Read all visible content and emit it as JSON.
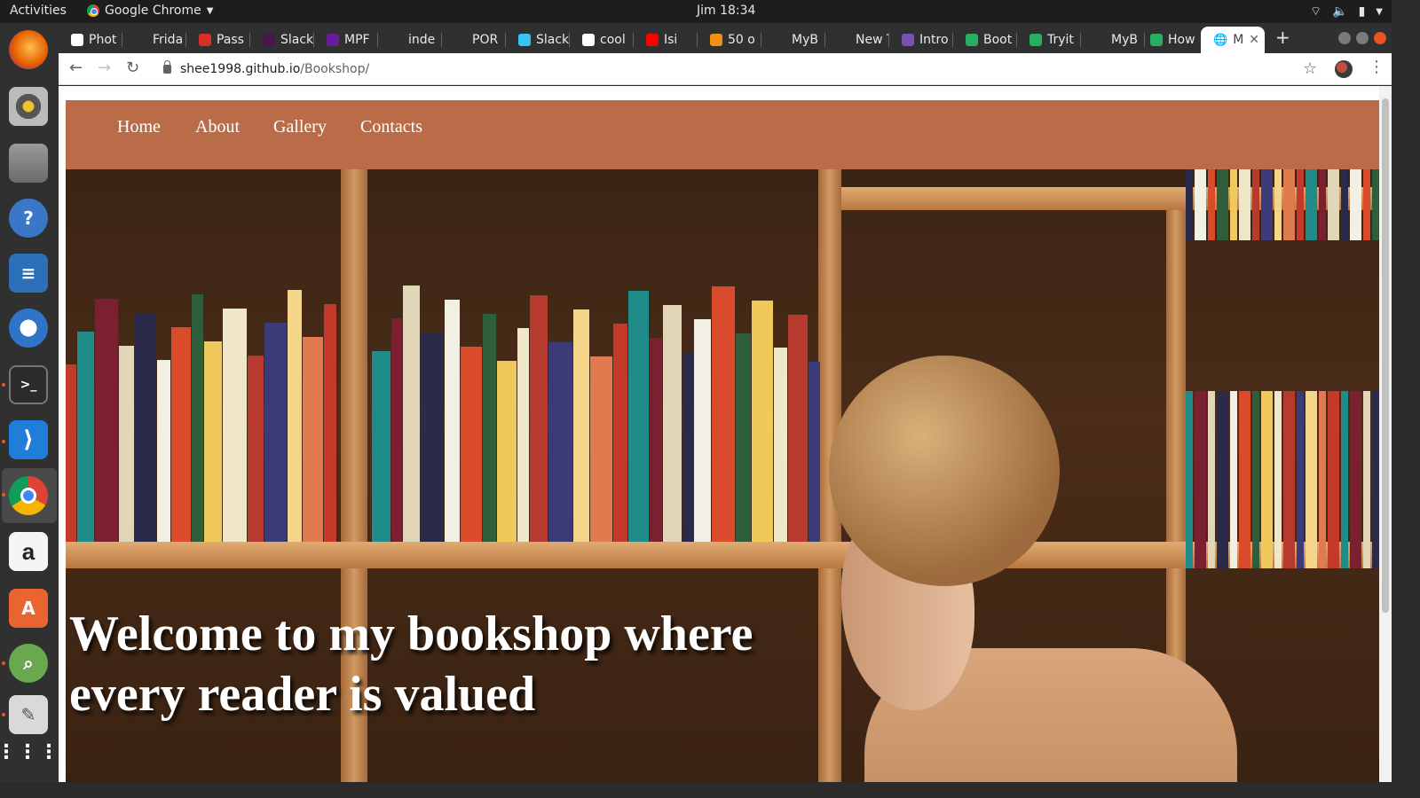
{
  "topbar": {
    "activities": "Activities",
    "app_name": "Google Chrome",
    "clock": "Jim 18:34"
  },
  "dock": {
    "items": [
      {
        "name": "firefox-icon",
        "color": "#e66000"
      },
      {
        "name": "rhythmbox-icon",
        "color": "#777777"
      },
      {
        "name": "files-icon",
        "color": "#8a8a8a"
      },
      {
        "name": "help-icon",
        "color": "#3a77c9"
      },
      {
        "name": "writer-icon",
        "color": "#2a6fb8"
      },
      {
        "name": "thunderbird-icon",
        "color": "#2e74c7"
      },
      {
        "name": "terminal-icon",
        "color": "#2b2b2b"
      },
      {
        "name": "vscode-icon",
        "color": "#1e7ed8"
      },
      {
        "name": "chrome-icon",
        "color": "#ffffff"
      },
      {
        "name": "amazon-icon",
        "color": "#f5f5f5"
      },
      {
        "name": "software-icon",
        "color": "#e9642e"
      },
      {
        "name": "image-viewer-icon",
        "color": "#6aa84f"
      },
      {
        "name": "text-editor-icon",
        "color": "#d9d9d9"
      },
      {
        "name": "app-grid-icon",
        "color": "#303030"
      }
    ]
  },
  "browser": {
    "tabs": [
      {
        "label": "Phot",
        "color": "#ffffff"
      },
      {
        "label": "Frida",
        "color": "#2f3031"
      },
      {
        "label": "Pass",
        "color": "#d93025"
      },
      {
        "label": "Slack",
        "color": "#4a154b"
      },
      {
        "label": "MPF",
        "color": "#6a1b9a"
      },
      {
        "label": "inde",
        "color": "#2f3031"
      },
      {
        "label": "POR",
        "color": "#2f3031"
      },
      {
        "label": "Slack",
        "color": "#36c5f0"
      },
      {
        "label": "cool",
        "color": "#ffffff"
      },
      {
        "label": "Isi",
        "color": "#ff0000"
      },
      {
        "label": "50 o",
        "color": "#f29111"
      },
      {
        "label": "MyB",
        "color": "#2f3031"
      },
      {
        "label": "New Tab",
        "color": "#2f3031"
      },
      {
        "label": "Intro",
        "color": "#7952b3"
      },
      {
        "label": "Boot",
        "color": "#27ae60"
      },
      {
        "label": "Tryit",
        "color": "#27ae60"
      },
      {
        "label": "MyB",
        "color": "#2f3031"
      },
      {
        "label": "How",
        "color": "#27ae60"
      }
    ],
    "active_tab": {
      "label": "M"
    },
    "url_host": "shee1998.github.io",
    "url_path": "/Bookshop/"
  },
  "site": {
    "nav_color": "#b96c47",
    "nav": [
      "Home",
      "About",
      "Gallery",
      "Contacts"
    ],
    "hero_title": "Welcome to my bookshop where every reader is valued"
  }
}
